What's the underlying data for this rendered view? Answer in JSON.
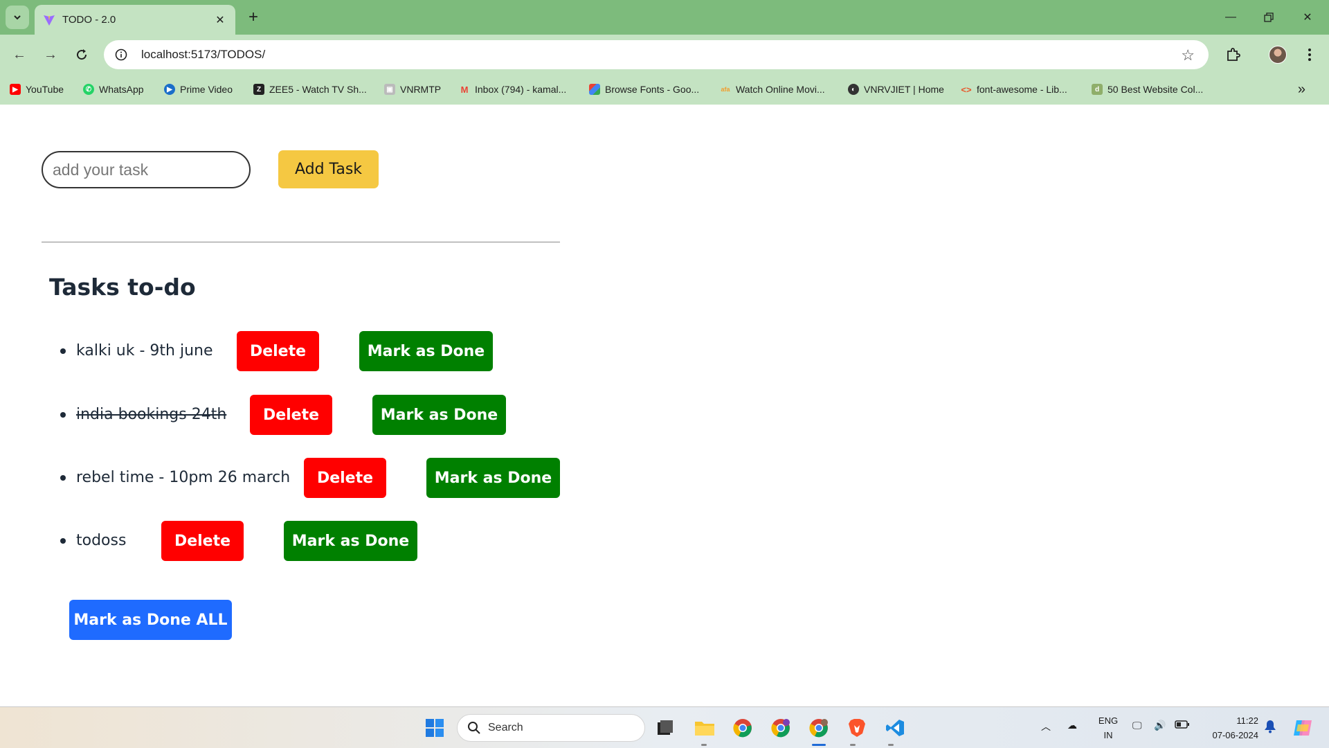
{
  "browser": {
    "tab_title": "TODO - 2.0",
    "url": "localhost:5173/TODOS/",
    "bookmarks": [
      {
        "label": "YouTube",
        "icon": "youtube-icon",
        "color": "#ff0000"
      },
      {
        "label": "WhatsApp",
        "icon": "whatsapp-icon",
        "color": "#25d366"
      },
      {
        "label": "Prime Video",
        "icon": "prime-video-icon",
        "color": "#1a98ff"
      },
      {
        "label": "ZEE5 - Watch TV Sh...",
        "icon": "zee5-icon",
        "color": "#222222"
      },
      {
        "label": "VNRMTP",
        "icon": "vnrmtp-icon",
        "color": "#888888"
      },
      {
        "label": "Inbox (794) - kamal...",
        "icon": "gmail-icon",
        "color": "#ea4335"
      },
      {
        "label": "Browse Fonts - Goo...",
        "icon": "google-fonts-icon",
        "color": "#4285f4"
      },
      {
        "label": "Watch Online Movi...",
        "icon": "movies-icon",
        "color": "#f29c2b"
      },
      {
        "label": "VNRVJIET | Home",
        "icon": "vnrvjiet-icon",
        "color": "#333333"
      },
      {
        "label": "font-awesome - Lib...",
        "icon": "code-icon",
        "color": "#e8562a"
      },
      {
        "label": "50 Best Website Col...",
        "icon": "website-colors-icon",
        "color": "#8fae6a"
      }
    ]
  },
  "app": {
    "input_placeholder": "add your task",
    "add_button": "Add Task",
    "heading": "Tasks to-do",
    "tasks": [
      {
        "text": "kalki uk - 9th june",
        "done": false
      },
      {
        "text": "india bookings 24th",
        "done": true
      },
      {
        "text": "rebel time - 10pm 26 march",
        "done": false
      },
      {
        "text": "todoss",
        "done": false
      }
    ],
    "delete_label": "Delete",
    "done_label": "Mark as Done",
    "done_all_label": "Mark as Done ALL"
  },
  "taskbar": {
    "search_label": "Search",
    "language": "ENG",
    "region": "IN",
    "time": "11:22",
    "date": "07-06-2024"
  },
  "colors": {
    "chrome_frame": "#7dbb7c",
    "chrome_toolbar": "#c4e3c2",
    "add_button": "#f5c842",
    "delete_button": "#ff0000",
    "done_button": "#008000",
    "done_all_button": "#1f6bff"
  }
}
